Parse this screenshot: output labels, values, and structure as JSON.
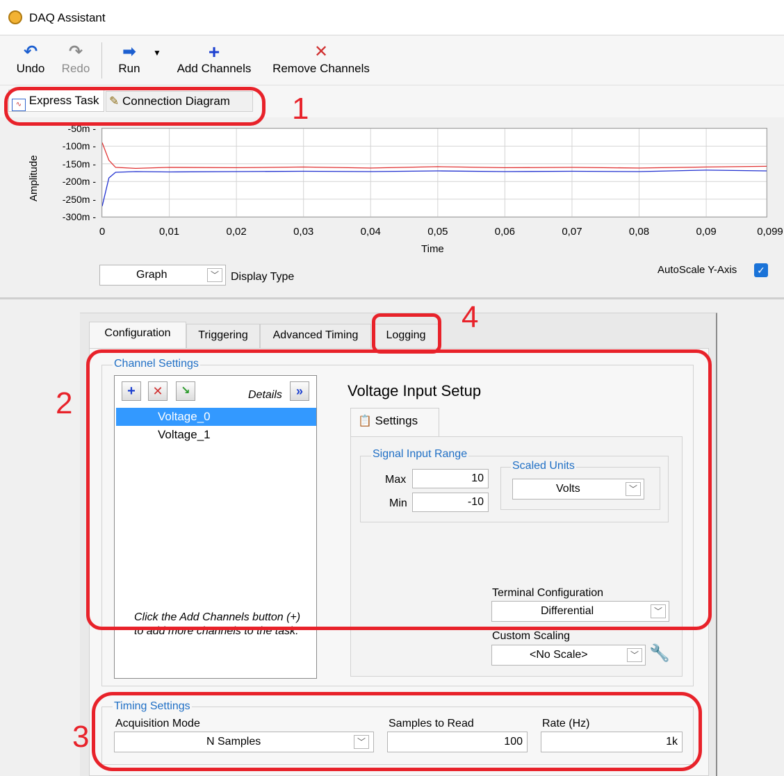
{
  "window": {
    "title": "DAQ Assistant"
  },
  "toolbar": {
    "undo": "Undo",
    "redo": "Redo",
    "run": "Run",
    "add_channels": "Add Channels",
    "remove_channels": "Remove Channels"
  },
  "view_tabs": [
    "Express Task",
    "Connection Diagram"
  ],
  "chart_data": {
    "type": "line",
    "xlabel": "Time",
    "ylabel": "Amplitude",
    "x_ticks": [
      "0",
      "0,01",
      "0,02",
      "0,03",
      "0,04",
      "0,05",
      "0,06",
      "0,07",
      "0,08",
      "0,09",
      "0,099"
    ],
    "y_ticks": [
      "-50m",
      "-100m",
      "-150m",
      "-200m",
      "-250m",
      "-300m"
    ],
    "xlim": [
      0,
      0.099
    ],
    "ylim": [
      -0.3,
      -0.05
    ],
    "grid": true,
    "series": [
      {
        "color": "#e03030",
        "x": [
          0,
          0.001,
          0.002,
          0.005,
          0.01,
          0.02,
          0.03,
          0.04,
          0.05,
          0.06,
          0.07,
          0.08,
          0.09,
          0.099
        ],
        "y": [
          -0.09,
          -0.14,
          -0.16,
          -0.163,
          -0.16,
          -0.161,
          -0.159,
          -0.162,
          -0.158,
          -0.161,
          -0.16,
          -0.162,
          -0.159,
          -0.157
        ]
      },
      {
        "color": "#2030d0",
        "x": [
          0,
          0.001,
          0.002,
          0.005,
          0.01,
          0.02,
          0.03,
          0.04,
          0.05,
          0.06,
          0.07,
          0.08,
          0.09,
          0.099
        ],
        "y": [
          -0.27,
          -0.19,
          -0.174,
          -0.172,
          -0.173,
          -0.172,
          -0.171,
          -0.172,
          -0.17,
          -0.172,
          -0.171,
          -0.172,
          -0.168,
          -0.17
        ]
      }
    ]
  },
  "display": {
    "type_value": "Graph",
    "type_label": "Display Type",
    "autoscale_label": "AutoScale Y-Axis",
    "autoscale_checked": true
  },
  "config_tabs": [
    "Configuration",
    "Triggering",
    "Advanced Timing",
    "Logging"
  ],
  "channel_settings": {
    "title": "Channel Settings",
    "details": "Details",
    "channels": [
      "Voltage_0",
      "Voltage_1"
    ],
    "hint": "Click the Add Channels button (+) to add more channels to the task."
  },
  "voltage_setup": {
    "title": "Voltage Input Setup",
    "settings_tab": "Settings",
    "signal_range_title": "Signal Input Range",
    "max_label": "Max",
    "max_value": "10",
    "min_label": "Min",
    "min_value": "-10",
    "scaled_units_title": "Scaled Units",
    "scaled_units_value": "Volts",
    "terminal_config_label": "Terminal Configuration",
    "terminal_config_value": "Differential",
    "custom_scaling_label": "Custom Scaling",
    "custom_scaling_value": "<No Scale>"
  },
  "timing": {
    "title": "Timing Settings",
    "mode_label": "Acquisition Mode",
    "mode_value": "N Samples",
    "samples_label": "Samples to Read",
    "samples_value": "100",
    "rate_label": "Rate (Hz)",
    "rate_value": "1k"
  },
  "annotations": [
    "1",
    "2",
    "3",
    "4"
  ],
  "colors": {
    "annotation": "#e8222a",
    "group_title": "#1f6fc5",
    "selection": "#3399ff"
  }
}
